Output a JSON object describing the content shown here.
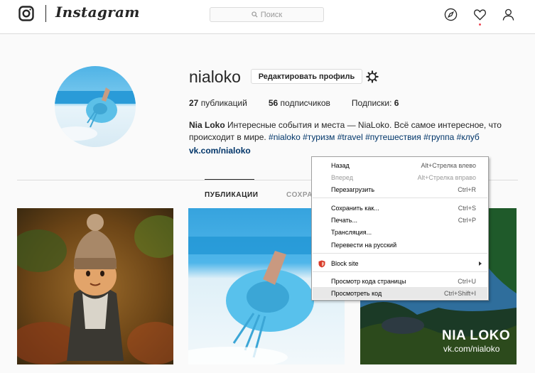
{
  "nav": {
    "wordmark": "Instagram",
    "search_placeholder": "Поиск",
    "icons": [
      "instagram-logo-icon",
      "compass-icon",
      "heart-icon",
      "user-icon"
    ]
  },
  "profile": {
    "username": "nialoko",
    "edit_label": "Редактировать профиль",
    "stats": {
      "posts_count": "27",
      "posts_label": "публикаций",
      "followers_count": "56",
      "followers_label": "подписчиков",
      "following_label": "Подписки:",
      "following_count": "6"
    },
    "bio": {
      "name": "Nia Loko",
      "text_1": "Интересные события и места — NiaLoko. Всё самое интересное, что происходит в мире.",
      "tags": [
        "#nialoko",
        "#туризм",
        "#travel",
        "#путешествия",
        "#группа",
        "#клуб"
      ],
      "link": "vk.com/nialoko"
    }
  },
  "tabs": {
    "posts": "ПУБЛИКАЦИИ",
    "saved": "СОХРА"
  },
  "posts": {
    "overlay_title": "NIA LOKO",
    "overlay_sub": "vk.com/nialoko"
  },
  "context_menu": {
    "items": [
      {
        "label": "Назад",
        "shortcut": "Alt+Стрелка влево",
        "disabled": false
      },
      {
        "label": "Вперед",
        "shortcut": "Alt+Стрелка вправо",
        "disabled": true
      },
      {
        "label": "Перезагрузить",
        "shortcut": "Ctrl+R",
        "disabled": false
      },
      {
        "label": "Сохранить как...",
        "shortcut": "Ctrl+S",
        "disabled": false
      },
      {
        "label": "Печать...",
        "shortcut": "Ctrl+P",
        "disabled": false
      },
      {
        "label": "Трансляция...",
        "shortcut": "",
        "disabled": false
      },
      {
        "label": "Перевести на русский",
        "shortcut": "",
        "disabled": false
      },
      {
        "label": "Block site",
        "shortcut": "",
        "disabled": false,
        "submenu": true
      },
      {
        "label": "Просмотр кода страницы",
        "shortcut": "Ctrl+U",
        "disabled": false
      },
      {
        "label": "Просмотреть код",
        "shortcut": "Ctrl+Shift+I",
        "disabled": false,
        "highlighted": true
      }
    ]
  },
  "colors": {
    "link": "#003569",
    "notification_dot": "#ed4956",
    "border": "#dbdbdb"
  }
}
